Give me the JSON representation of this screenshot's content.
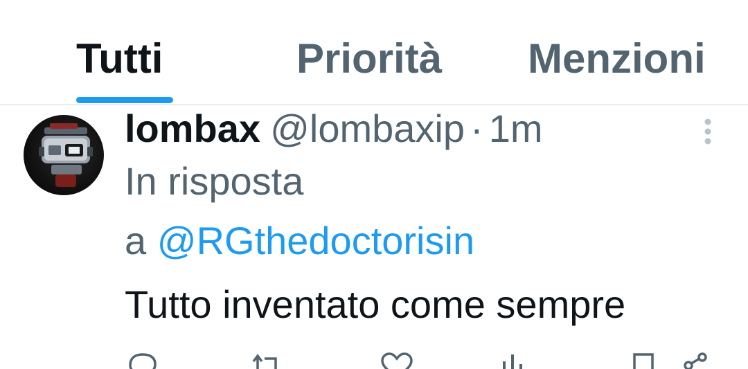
{
  "tabs": [
    {
      "label": "Tutti",
      "active": true
    },
    {
      "label": "Priorità",
      "active": false
    },
    {
      "label": "Menzioni",
      "active": false
    }
  ],
  "tweet": {
    "display_name": "lombax",
    "handle": "@lombaxip",
    "separator": "·",
    "time": "1m",
    "reply_prefix": "In risposta",
    "reply_a": "a",
    "reply_to": "@RGthedoctorisin",
    "text": "Tutto inventato come sempre"
  },
  "actions": [
    "reply-icon",
    "retweet-icon",
    "like-icon",
    "views-icon",
    "bookmark-icon",
    "share-icon"
  ],
  "colors": {
    "accent": "#1d9bf0",
    "primary_text": "#0f1419",
    "secondary_text": "#536471",
    "divider": "#e6ecf0"
  }
}
